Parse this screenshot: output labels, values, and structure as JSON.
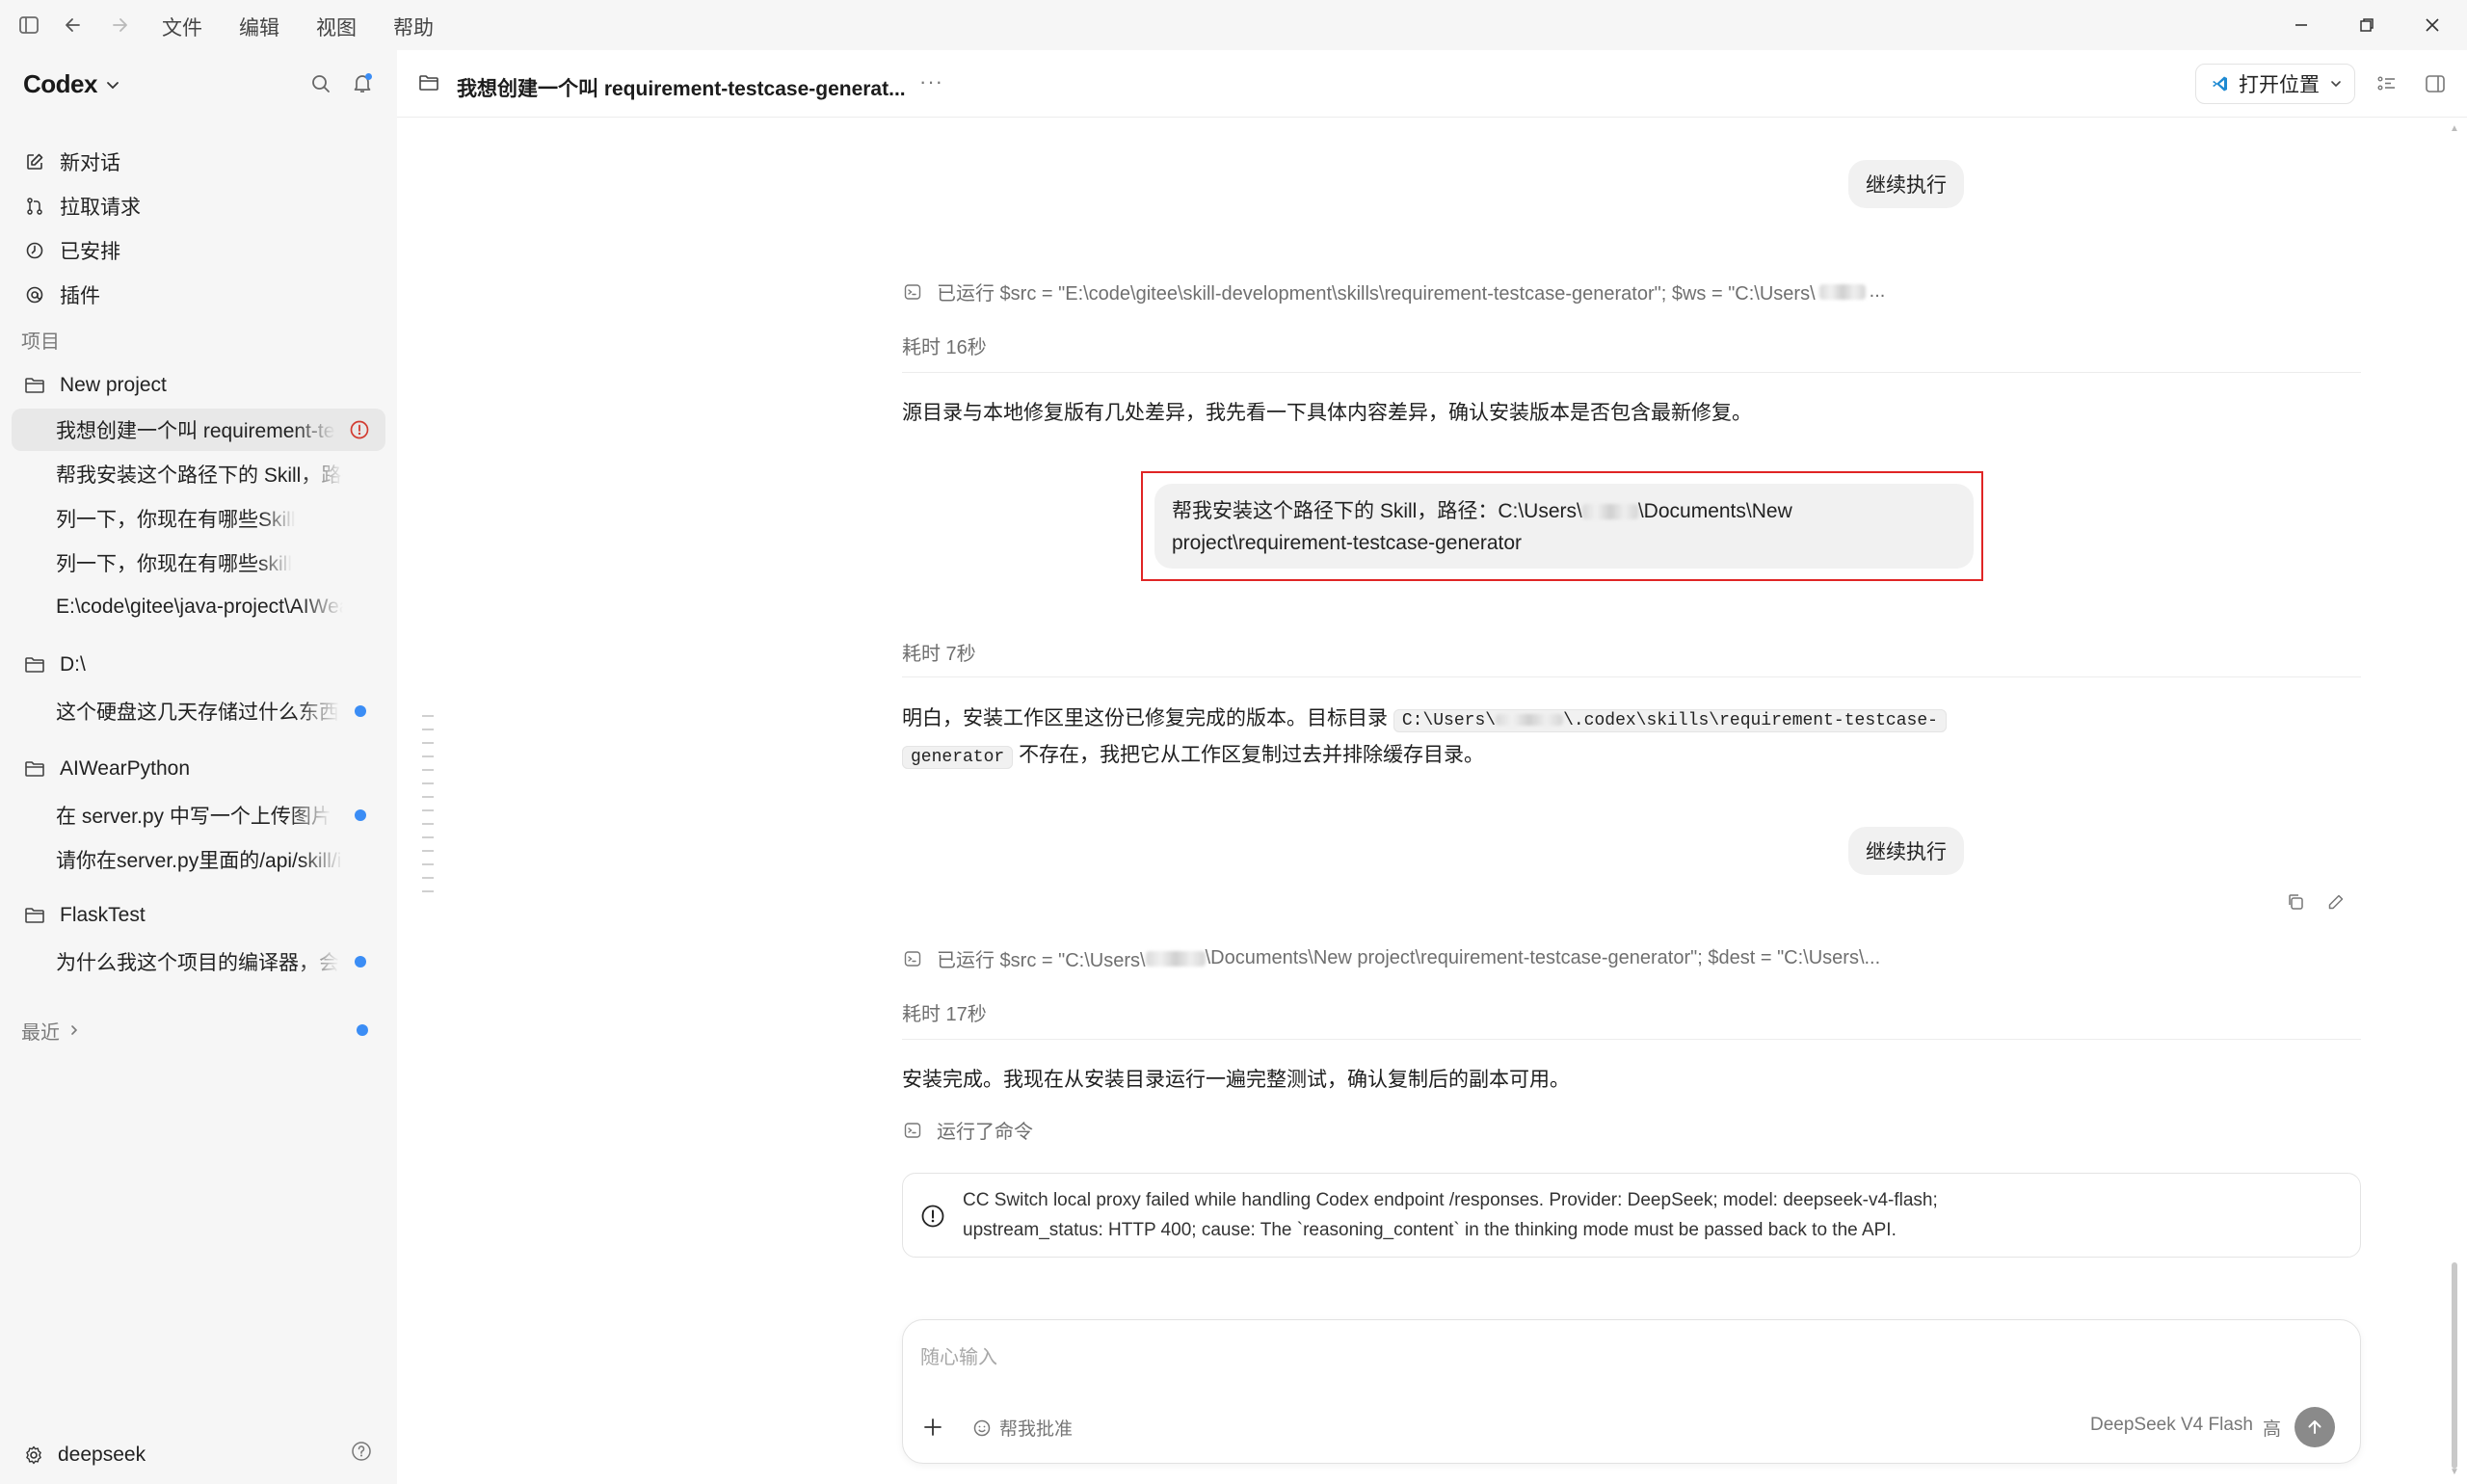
{
  "menu": {
    "items": [
      "文件",
      "编辑",
      "视图",
      "帮助"
    ]
  },
  "sidebar": {
    "brand": "Codex",
    "nav": [
      {
        "label": "新对话",
        "icon": "edit-icon"
      },
      {
        "label": "拉取请求",
        "icon": "pull-request-icon"
      },
      {
        "label": "已安排",
        "icon": "clock-icon"
      },
      {
        "label": "插件",
        "icon": "plugin-icon"
      }
    ],
    "projects_label": "项目",
    "projects": [
      {
        "name": "New project",
        "threads": [
          {
            "title": "我想创建一个叫 requirement-testcase-generator",
            "active": true,
            "status": "error"
          },
          {
            "title": "帮我安装这个路径下的 Skill，路径：",
            "active": false,
            "status": ""
          },
          {
            "title": "列一下，你现在有哪些Skill",
            "active": false,
            "status": ""
          },
          {
            "title": "列一下，你现在有哪些skill",
            "active": false,
            "status": ""
          },
          {
            "title": "E:\\code\\gitee\\java-project\\AIWear-",
            "active": false,
            "status": ""
          }
        ]
      },
      {
        "name": "D:\\",
        "threads": [
          {
            "title": "这个硬盘这几天存储过什么东西",
            "active": false,
            "status": "unread"
          }
        ]
      },
      {
        "name": "AIWearPython",
        "threads": [
          {
            "title": "在 server.py 中写一个上传图片",
            "active": false,
            "status": "unread"
          },
          {
            "title": "请你在server.py里面的/api/skill/image",
            "active": false,
            "status": ""
          }
        ]
      },
      {
        "name": "FlaskTest",
        "threads": [
          {
            "title": "为什么我这个项目的编译器，会",
            "active": false,
            "status": "unread"
          }
        ]
      }
    ],
    "recent_label": "最近",
    "footer_user": "deepseek"
  },
  "header": {
    "title": "我想创建一个叫 requirement-testcase-generat...",
    "more": "···",
    "open_location": "打开位置"
  },
  "conversation": {
    "user_msg_1": "继续执行",
    "run_1": "已运行 $src = \"E:\\code\\gitee\\skill-development\\skills\\requirement-testcase-generator\"; $ws = \"C:\\Users\\",
    "run_1_tail": "...",
    "elapsed_1": "耗时 16秒",
    "assistant_1": "源目录与本地修复版有几处差异，我先看一下具体内容差异，确认安装版本是否包含最新修复。",
    "user_msg_2_line1_a": "帮我安装这个路径下的 Skill，路径：C:\\Users\\",
    "user_msg_2_line1_b": "\\Documents\\New",
    "user_msg_2_line2": "project\\requirement-testcase-generator",
    "elapsed_2": "耗时 7秒",
    "assistant_2_a": "明白，安装工作区里这份已修复完成的版本。目标目录",
    "assistant_2_code_a": "C:\\Users\\",
    "assistant_2_code_b": "\\.codex\\skills\\requirement-testcase-",
    "assistant_2_code_c": "generator",
    "assistant_2_b": "不存在，我把它从工作区复制过去并排除缓存目录。",
    "user_msg_3": "继续执行",
    "run_2_a": "已运行 $src = \"C:\\Users\\",
    "run_2_b": "\\Documents\\New project\\requirement-testcase-generator\"; $dest = \"C:\\Users\\...",
    "elapsed_3": "耗时 17秒",
    "assistant_3": "安装完成。我现在从安装目录运行一遍完整测试，确认复制后的副本可用。",
    "ran_command": "运行了命令",
    "error_line1": "CC Switch local proxy failed while handling Codex endpoint /responses. Provider: DeepSeek; model: deepseek-v4-flash;",
    "error_line2": "upstream_status: HTTP 400; cause: The `reasoning_content` in the thinking mode must be passed back to the API."
  },
  "composer": {
    "placeholder": "随心输入",
    "approve_label": "帮我批准",
    "model": "DeepSeek V4 Flash",
    "effort": "高"
  },
  "colors": {
    "accent_blue": "#3b8df5",
    "highlight_red": "#e02525",
    "error_red": "#d23b30"
  }
}
